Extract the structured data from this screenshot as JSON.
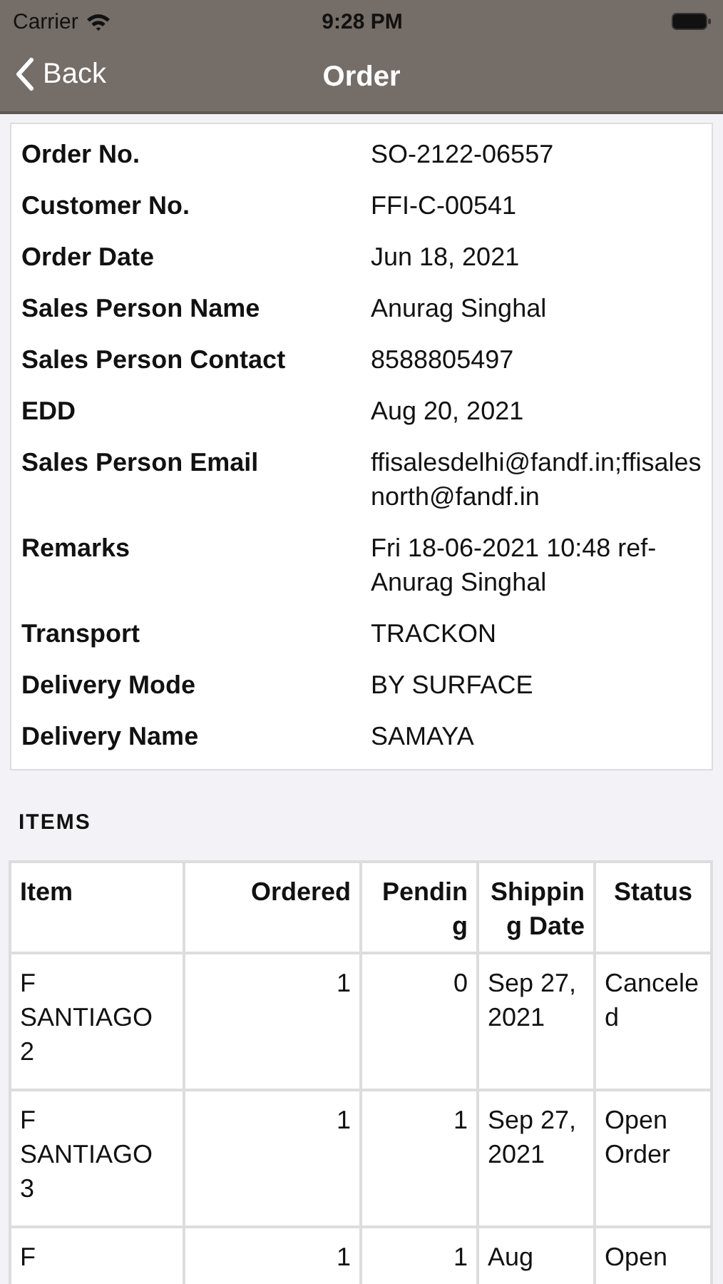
{
  "status_bar": {
    "carrier": "Carrier",
    "time": "9:28 PM"
  },
  "nav": {
    "back": "Back",
    "title": "Order"
  },
  "details": [
    {
      "label": "Order No.",
      "value": "SO-2122-06557"
    },
    {
      "label": "Customer No.",
      "value": "FFI-C-00541"
    },
    {
      "label": "Order Date",
      "value": "Jun 18, 2021"
    },
    {
      "label": "Sales Person Name",
      "value": "Anurag Singhal"
    },
    {
      "label": "Sales Person Contact",
      "value": "8588805497"
    },
    {
      "label": "EDD",
      "value": "Aug 20, 2021"
    },
    {
      "label": "Sales Person Email",
      "value": "ffisalesdelhi@fandf.in;ffisalesnorth@fandf.in"
    },
    {
      "label": "Remarks",
      "value": "Fri 18-06-2021 10:48 ref-Anurag Singhal"
    },
    {
      "label": "Transport",
      "value": "TRACKON"
    },
    {
      "label": "Delivery Mode",
      "value": "BY SURFACE"
    },
    {
      "label": "Delivery Name",
      "value": "SAMAYA"
    }
  ],
  "items": {
    "title": "ITEMS",
    "columns": [
      "Item",
      "Ordered",
      "Pending",
      "Shipping Date",
      "Status"
    ],
    "rows": [
      [
        "F SANTIAGO 2",
        "1",
        "0",
        "Sep 27, 2021",
        "Canceled"
      ],
      [
        "F SANTIAGO 3",
        "1",
        "1",
        "Sep 27, 2021",
        "Open Order"
      ],
      [
        "F",
        "1",
        "1",
        "Aug",
        "Open"
      ]
    ]
  }
}
